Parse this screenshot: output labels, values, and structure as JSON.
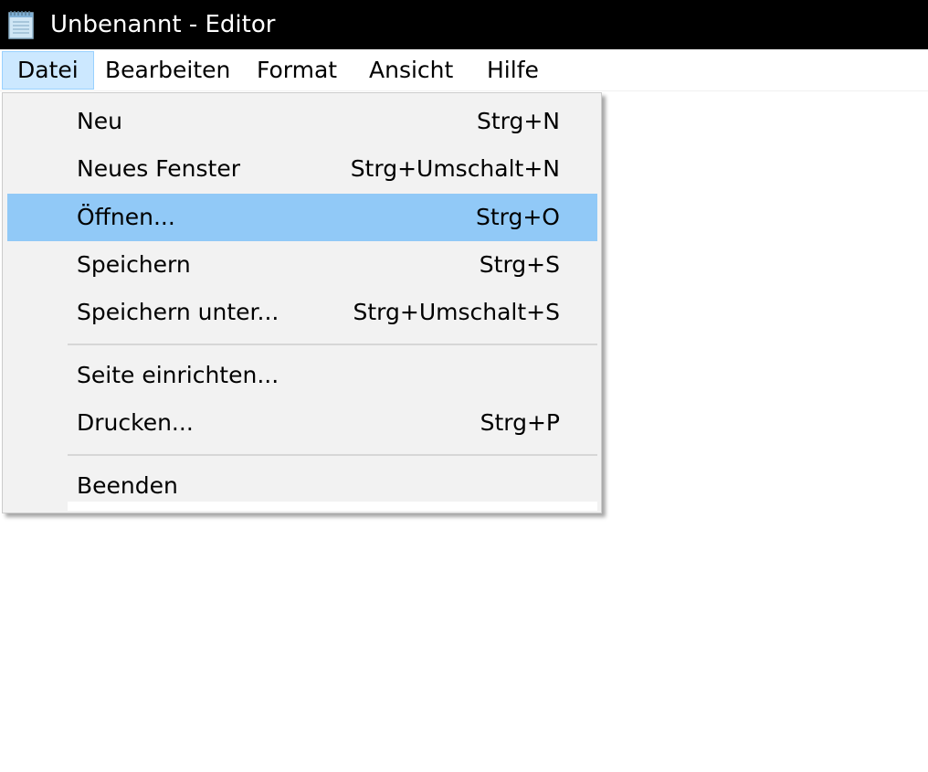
{
  "window": {
    "title": "Unbenannt - Editor",
    "app_icon": "notepad-icon"
  },
  "menubar": {
    "items": [
      {
        "label": "Datei",
        "active": true
      },
      {
        "label": "Bearbeiten",
        "active": false
      },
      {
        "label": "Format",
        "active": false
      },
      {
        "label": "Ansicht",
        "active": false
      },
      {
        "label": "Hilfe",
        "active": false
      }
    ]
  },
  "file_menu": {
    "items": [
      {
        "label": "Neu",
        "shortcut": "Strg+N"
      },
      {
        "label": "Neues Fenster",
        "shortcut": "Strg+Umschalt+N"
      },
      {
        "label": "Öffnen...",
        "shortcut": "Strg+O",
        "highlighted": true
      },
      {
        "label": "Speichern",
        "shortcut": "Strg+S"
      },
      {
        "label": "Speichern unter...",
        "shortcut": "Strg+Umschalt+S"
      },
      {
        "label": "Seite einrichten...",
        "shortcut": ""
      },
      {
        "label": "Drucken...",
        "shortcut": "Strg+P"
      },
      {
        "label": "Beenden",
        "shortcut": ""
      }
    ]
  },
  "colors": {
    "titlebar_bg": "#000000",
    "menu_highlight": "#91c9f7",
    "menubar_active_bg": "#cce8ff",
    "menu_bg": "#f2f2f2"
  }
}
